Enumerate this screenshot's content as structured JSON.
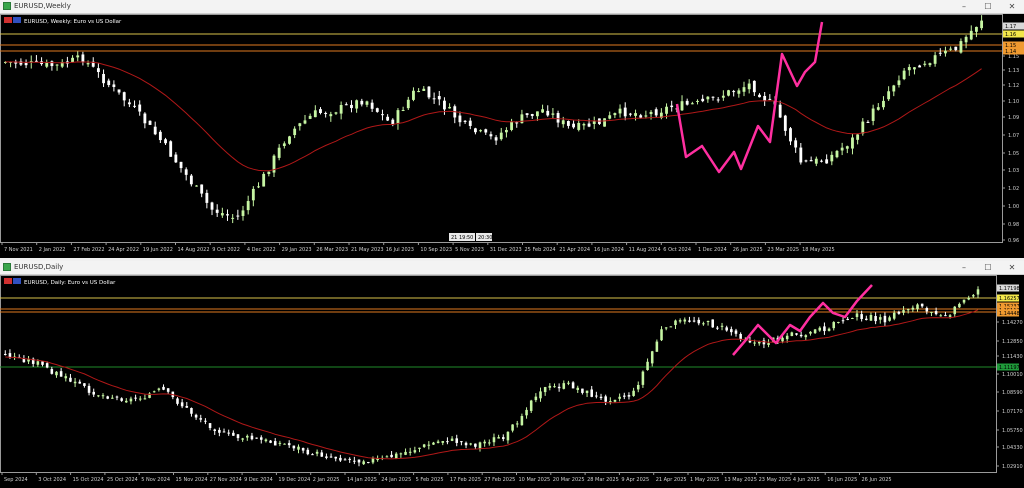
{
  "weekly": {
    "window_title": "EURUSD,Weekly",
    "header_text": "EURUSD, Weekly:  Euro vs US Dollar",
    "price_labels": [
      "1.15",
      "1.13",
      "1.12",
      "1.10",
      "1.09",
      "1.07",
      "1.05",
      "1.03",
      "1.02",
      "1.00",
      "0.98",
      "0.96"
    ],
    "tag_labels": [
      "1.17",
      "1.16",
      "1.15",
      "1.14"
    ],
    "date_labels": [
      "7 Nov 2021",
      "2 Jan 2022",
      "27 Feb 2022",
      "24 Apr 2022",
      "19 Jun 2022",
      "14 Aug 2022",
      "9 Oct 2022",
      "4 Dec 2022",
      "29 Jan 2023",
      "26 Mar 2023",
      "21 May 2023",
      "16 Jul 2023",
      "10 Sep 2023",
      "5 Nov 2023",
      "31 Dec 2023",
      "25 Feb 2024",
      "21 Apr 2024",
      "16 Jun 2024",
      "11 Aug 2024",
      "6 Oct 2024",
      "1 Dec 2024",
      "26 Jan 2025",
      "23 Mar 2025",
      "18 May 2025"
    ],
    "crosshair_labels": [
      "21 19:50",
      "20:30"
    ]
  },
  "daily": {
    "window_title": "EURUSD,Daily",
    "header_text": "EURUSD, Daily:  Euro vs US Dollar",
    "price_labels": [
      "1.14270",
      "1.12850",
      "1.11430",
      "1.10010",
      "1.08590",
      "1.07170",
      "1.05750",
      "1.04330",
      "1.02910"
    ],
    "tag_labels": [
      "1.17198",
      "1.16257",
      "1.15237",
      "1.15112",
      "1.14448",
      "1.11197"
    ],
    "date_labels": [
      "Sep 2024",
      "3 Oct 2024",
      "15 Oct 2024",
      "25 Oct 2024",
      "5 Nov 2024",
      "15 Nov 2024",
      "27 Nov 2024",
      "9 Dec 2024",
      "19 Dec 2024",
      "2 Jan 2025",
      "14 Jan 2025",
      "24 Jan 2025",
      "5 Feb 2025",
      "17 Feb 2025",
      "27 Feb 2025",
      "10 Mar 2025",
      "20 Mar 2025",
      "28 Mar 2025",
      "9 Apr 2025",
      "21 Apr 2025",
      "1 May 2025",
      "13 May 2025",
      "23 May 2025",
      "4 Jun 2025",
      "16 Jun 2025",
      "26 Jun 2025"
    ]
  },
  "colors": {
    "bull": "#c6f5a3",
    "bear": "#ffffff",
    "ma": "#b01818",
    "zigzag": "#ff2fa0",
    "hline_yellow": "#d8c24a",
    "hline_orange": "#e07a20",
    "hline_green": "#1f8a2a",
    "grid": "#9a9a9a",
    "tag_yellow": "#f2e64a",
    "tag_orange": "#f09a30",
    "tag_green": "#1f9a3a"
  },
  "window_buttons": {
    "minimize": "–",
    "maximize": "☐",
    "close": "✕"
  }
}
